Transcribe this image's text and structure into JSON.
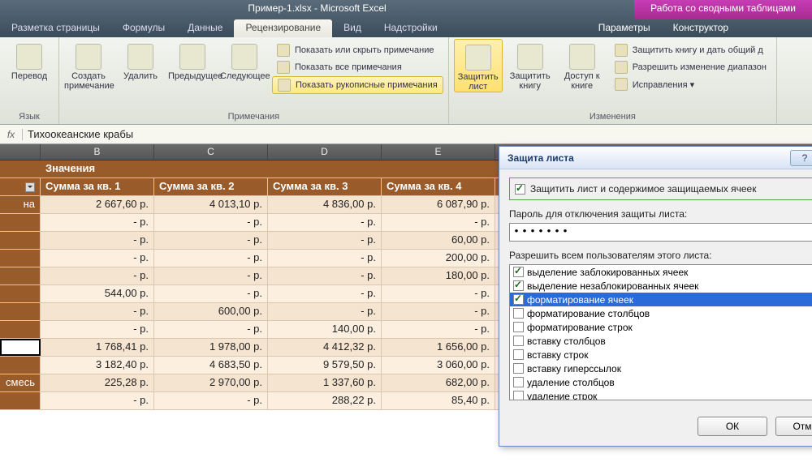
{
  "title": "Пример-1.xlsx - Microsoft Excel",
  "context_title": "Работа со сводными таблицами",
  "tabs": [
    "Разметка страницы",
    "Формулы",
    "Данные",
    "Рецензирование",
    "Вид",
    "Надстройки"
  ],
  "ctx_tabs": [
    "Параметры",
    "Конструктор"
  ],
  "ribbon": {
    "g1": {
      "label": "Язык",
      "btn": "Перевод"
    },
    "g2": {
      "label": "Примечания",
      "btns": [
        "Создать примечание",
        "Удалить",
        "Предыдущее",
        "Следующее"
      ],
      "opts": [
        "Показать или скрыть примечание",
        "Показать все примечания",
        "Показать рукописные примечания"
      ]
    },
    "g3": {
      "btns": [
        "Защитить лист",
        "Защитить книгу",
        "Доступ к книге"
      ]
    },
    "g4": {
      "label": "Изменения",
      "opts": [
        "Защитить книгу и дать общий д",
        "Разрешить изменение диапазон",
        "Исправления ▾"
      ]
    }
  },
  "formula": "Тихоокеанские крабы",
  "cols": [
    "B",
    "C",
    "D",
    "E"
  ],
  "section": "Значения",
  "headers": [
    "Сумма за кв. 1",
    "Сумма за кв. 2",
    "Сумма за кв. 3",
    "Сумма за кв. 4"
  ],
  "rowlabels": [
    "на",
    "",
    "",
    "",
    "",
    "",
    "",
    "",
    "",
    "",
    "смесь",
    ""
  ],
  "data": [
    [
      "2 667,60 р.",
      "4 013,10 р.",
      "4 836,00 р.",
      "6 087,90 р."
    ],
    [
      "-   р.",
      "-   р.",
      "-   р.",
      "-   р."
    ],
    [
      "-   р.",
      "-   р.",
      "-   р.",
      "60,00 р."
    ],
    [
      "-   р.",
      "-   р.",
      "-   р.",
      "200,00 р."
    ],
    [
      "-   р.",
      "-   р.",
      "-   р.",
      "180,00 р."
    ],
    [
      "544,00 р.",
      "-   р.",
      "-   р.",
      "-   р."
    ],
    [
      "-   р.",
      "600,00 р.",
      "-   р.",
      "-   р."
    ],
    [
      "-   р.",
      "-   р.",
      "140,00 р.",
      "-   р."
    ],
    [
      "1 768,41 р.",
      "1 978,00 р.",
      "4 412,32 р.",
      "1 656,00 р."
    ],
    [
      "3 182,40 р.",
      "4 683,50 р.",
      "9 579,50 р.",
      "3 060,00 р."
    ],
    [
      "225,28 р.",
      "2 970,00 р.",
      "1 337,60 р.",
      "682,00 р."
    ],
    [
      "-   р.",
      "-   р.",
      "288,22 р.",
      "85,40 р."
    ]
  ],
  "dialog": {
    "title": "Защита листа",
    "main_chk": "Защитить лист и содержимое защищаемых ячеек",
    "pw_label": "Пароль для отключения защиты листа:",
    "pw_value": "•••••••",
    "perm_label": "Разрешить всем пользователям этого листа:",
    "perms": [
      {
        "t": "выделение заблокированных ячеек",
        "c": true,
        "s": false
      },
      {
        "t": "выделение незаблокированных ячеек",
        "c": true,
        "s": false
      },
      {
        "t": "форматирование ячеек",
        "c": true,
        "s": true
      },
      {
        "t": "форматирование столбцов",
        "c": false,
        "s": false
      },
      {
        "t": "форматирование строк",
        "c": false,
        "s": false
      },
      {
        "t": "вставку столбцов",
        "c": false,
        "s": false
      },
      {
        "t": "вставку строк",
        "c": false,
        "s": false
      },
      {
        "t": "вставку гиперссылок",
        "c": false,
        "s": false
      },
      {
        "t": "удаление столбцов",
        "c": false,
        "s": false
      },
      {
        "t": "удаление строк",
        "c": false,
        "s": false
      }
    ],
    "ok": "ОК",
    "cancel": "Отмена"
  }
}
